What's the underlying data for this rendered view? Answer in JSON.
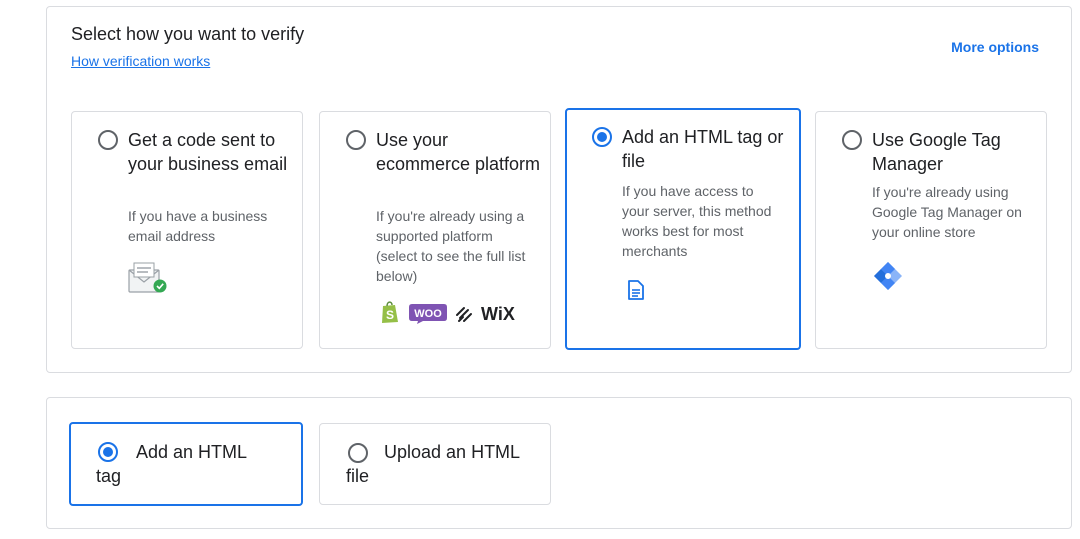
{
  "header": {
    "title": "Select how you want to verify",
    "help_link": "How verification works",
    "more_options": "More options"
  },
  "methods": [
    {
      "title": "Get a code sent to your business email",
      "description": "If you have a business email address",
      "icon": "envelope-check-icon",
      "selected": false
    },
    {
      "title": "Use your ecommerce platform",
      "description": "If you're already using a supported platform (select to see the full list below)",
      "logos": [
        "shopify-logo",
        "woo-logo",
        "squarespace-logo",
        "wix-logo"
      ],
      "logo_text": {
        "woo": "WOO",
        "wix": "WiX"
      },
      "selected": false
    },
    {
      "title": "Add an HTML tag or file",
      "description": "If you have access to your server, this method works best for most merchants",
      "icon": "document-icon",
      "selected": true
    },
    {
      "title": "Use Google Tag Manager",
      "description": "If you're already using Google Tag Manager on your online store",
      "icon": "google-tag-manager-icon",
      "selected": false
    }
  ],
  "html_options": [
    {
      "label": "Add an HTML tag",
      "selected": true
    },
    {
      "label": "Upload an HTML file",
      "selected": false
    }
  ],
  "colors": {
    "accent": "#1a73e8",
    "border": "#dadce0",
    "text_primary": "#202124",
    "text_secondary": "#5f6368"
  }
}
